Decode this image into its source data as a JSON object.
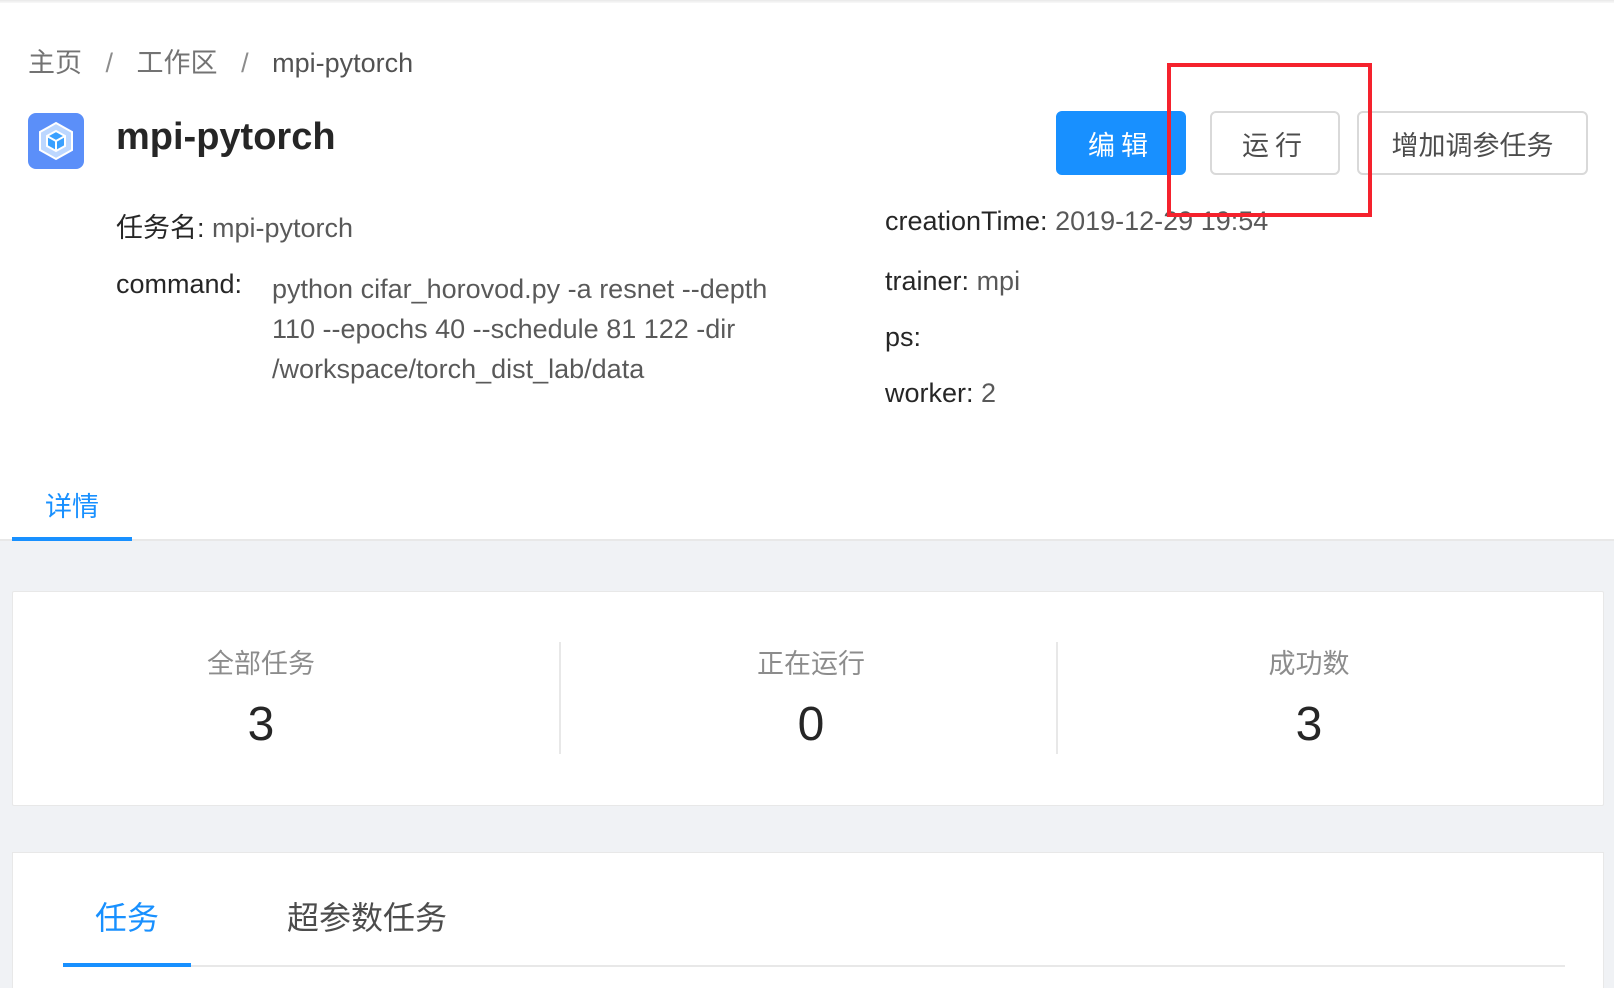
{
  "breadcrumb": {
    "items": [
      "主页",
      "工作区",
      "mpi-pytorch"
    ],
    "separator": "/"
  },
  "header": {
    "title": "mpi-pytorch",
    "logo_icon": "cube-icon",
    "buttons": {
      "edit": "编辑",
      "run": "运行",
      "tune": "增加调参任务"
    }
  },
  "details": {
    "task_name_label": "任务名:",
    "task_name_value": "mpi-pytorch",
    "command_label": "command:",
    "command_lines": [
      "python cifar_horovod.py -a resnet --depth",
      "110 --epochs 40 --schedule 81 122 -dir",
      "/workspace/torch_dist_lab/data"
    ],
    "creation_time_label": "creationTime:",
    "creation_time_value": "2019-12-29 19:54",
    "trainer_label": "trainer:",
    "trainer_value": "mpi",
    "ps_label": "ps:",
    "ps_value": "",
    "worker_label": "worker:",
    "worker_value": "2"
  },
  "detail_tab": "详情",
  "stats": [
    {
      "title": "全部任务",
      "value": "3"
    },
    {
      "title": "正在运行",
      "value": "0"
    },
    {
      "title": "成功数",
      "value": "3"
    }
  ],
  "task_tabs": [
    "任务",
    "超参数任务"
  ],
  "colors": {
    "primary": "#1890ff",
    "highlight": "#f5222d"
  }
}
